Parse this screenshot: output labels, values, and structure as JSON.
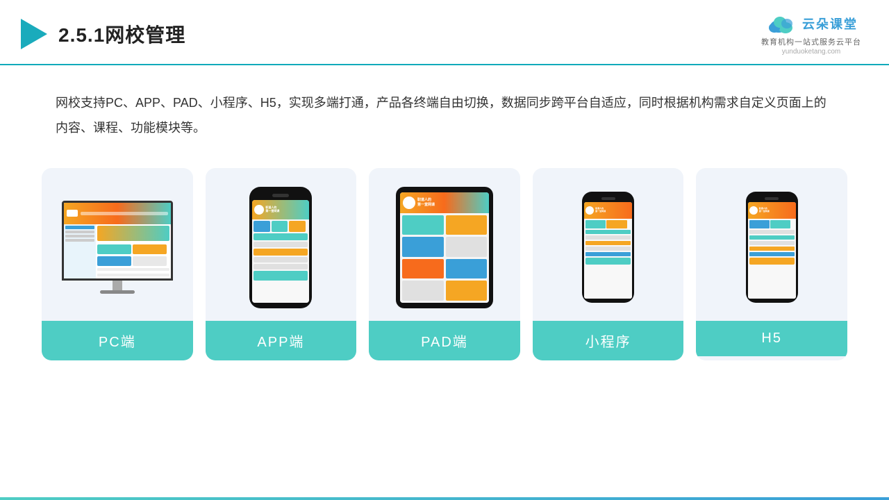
{
  "header": {
    "title": "2.5.1网校管理",
    "logo_main": "云朵课堂",
    "logo_url": "yunduoketang.com",
    "logo_sub": "教育机构一站式服务云平台"
  },
  "description": {
    "text": "网校支持PC、APP、PAD、小程序、H5，实现多端打通，产品各终端自由切换，数据同步跨平台自适应，同时根据机构需求自定义页面上的内容、课程、功能模块等。"
  },
  "cards": [
    {
      "label": "PC端",
      "type": "pc"
    },
    {
      "label": "APP端",
      "type": "phone"
    },
    {
      "label": "PAD端",
      "type": "tablet"
    },
    {
      "label": "小程序",
      "type": "miniphone"
    },
    {
      "label": "H5",
      "type": "miniphone2"
    }
  ]
}
